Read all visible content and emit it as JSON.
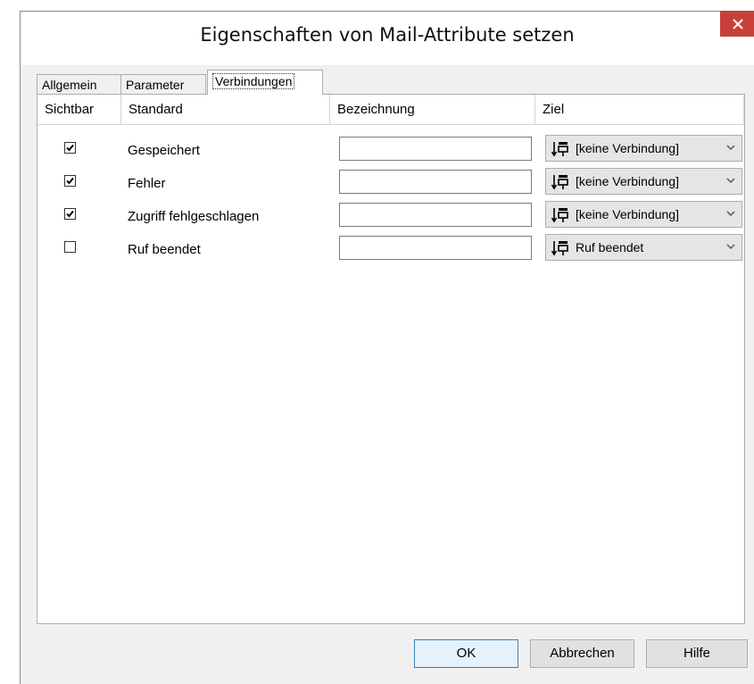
{
  "window": {
    "title": "Eigenschaften von Mail-Attribute setzen"
  },
  "tabs": [
    {
      "label": "Allgemein",
      "active": false
    },
    {
      "label": "Parameter",
      "active": false
    },
    {
      "label": "Verbindungen",
      "active": true
    }
  ],
  "table": {
    "headers": {
      "visible": "Sichtbar",
      "standard": "Standard",
      "label": "Bezeichnung",
      "target": "Ziel"
    },
    "rows": [
      {
        "visible": true,
        "standard": "Gespeichert",
        "label": "",
        "target": "[keine Verbindung]"
      },
      {
        "visible": true,
        "standard": "Fehler",
        "label": "",
        "target": "[keine Verbindung]"
      },
      {
        "visible": true,
        "standard": "Zugriff fehlgeschlagen",
        "label": "",
        "target": "[keine Verbindung]"
      },
      {
        "visible": false,
        "standard": "Ruf beendet",
        "label": "",
        "target": "Ruf beendet"
      }
    ]
  },
  "buttons": {
    "ok": "OK",
    "cancel": "Abbrechen",
    "help": "Hilfe"
  },
  "icons": {
    "close": "close-icon",
    "target": "connection-target-icon",
    "dropdown": "chevron-down-icon"
  },
  "colors": {
    "close_button": "#c7413a",
    "default_button_border": "#3c7fb1"
  }
}
